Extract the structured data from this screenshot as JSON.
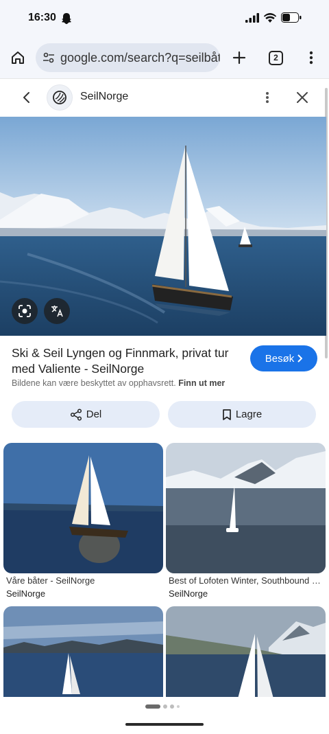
{
  "status": {
    "time": "16:30",
    "icons": [
      "snapchat-icon",
      "signal-icon",
      "wifi-icon",
      "battery-icon"
    ]
  },
  "browser": {
    "url": "google.com/search?q=seilbåt",
    "tab_count": "2",
    "icons": [
      "home-icon",
      "tune-icon",
      "plus-icon",
      "more-vert-icon"
    ]
  },
  "viewer": {
    "site_name": "SeilNorge",
    "icons": [
      "back-chevron-icon",
      "site-logo-icon",
      "more-vert-icon",
      "close-icon"
    ]
  },
  "result": {
    "title": "Ski & Seil Lyngen og Finnmark, privat tur med Valiente - SeilNorge",
    "visit_label": "Besøk",
    "copyright_text": "Bildene kan være beskyttet av opphavsrett.",
    "learn_more": "Finn ut mer",
    "share_label": "Del",
    "save_label": "Lagre"
  },
  "related": [
    {
      "title": "Våre båter - SeilNorge",
      "source": "SeilNorge"
    },
    {
      "title": "Best of Lofoten Winter, Southbound - SeilNorge",
      "source": "SeilNorge"
    },
    {
      "title": "",
      "source": ""
    },
    {
      "title": "",
      "source": ""
    }
  ],
  "pager": {
    "pages": 4,
    "current": 1
  },
  "colors": {
    "accent": "#1a73e8",
    "chip_bg": "#e5ecf8",
    "browser_bg": "#f4f6fb"
  }
}
